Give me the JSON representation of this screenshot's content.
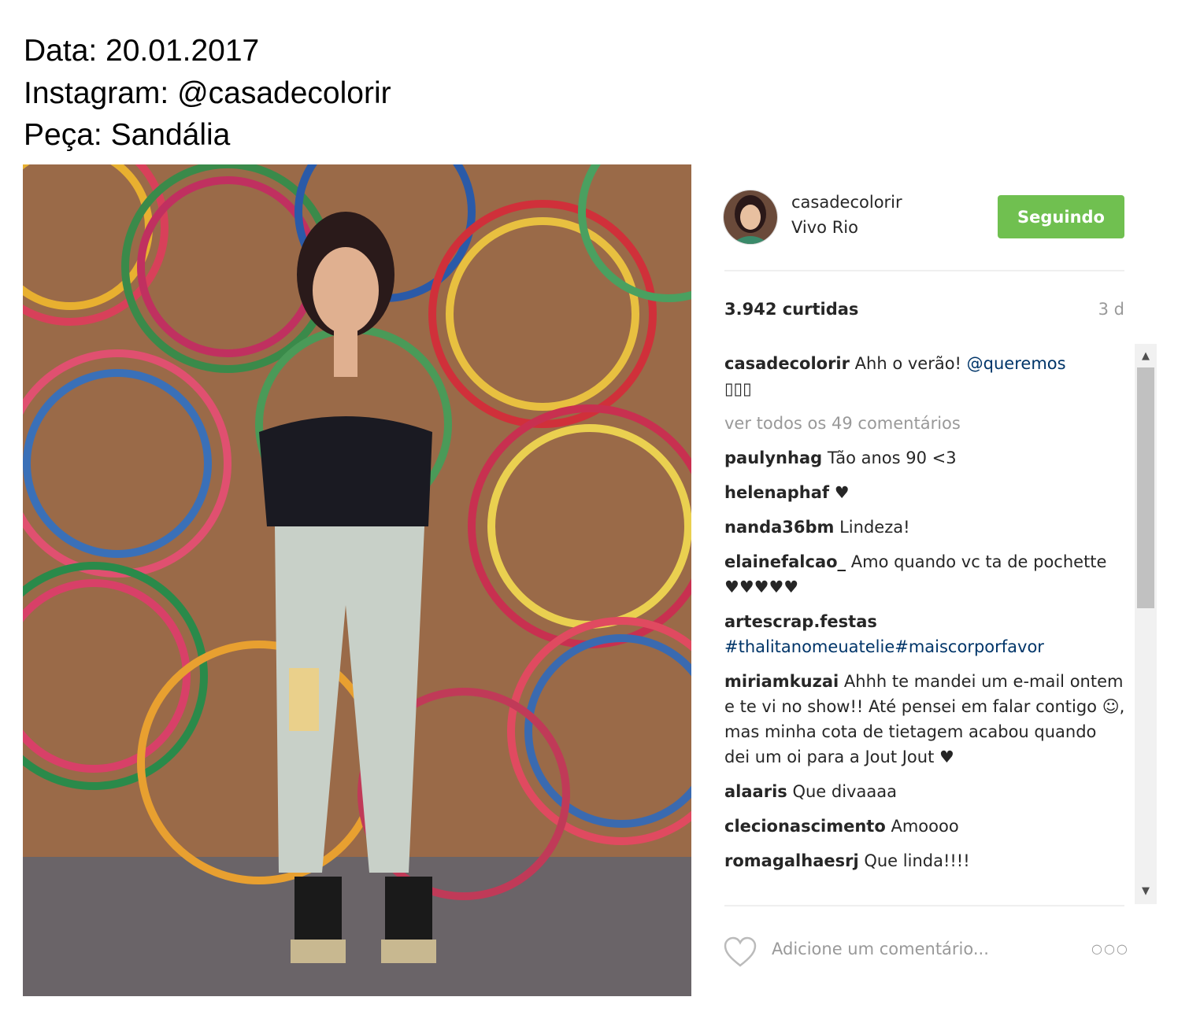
{
  "caption_header": {
    "line1": "Data: 20.01.2017",
    "line2": "Instagram: @casadecolorir",
    "line3": "Peça: Sandália"
  },
  "post": {
    "username": "casadecolorir",
    "location": "Vivo Rio",
    "follow_label": "Seguindo",
    "likes": "3.942 curtidas",
    "age": "3 d",
    "caption_user": "casadecolorir",
    "caption_text": "Ahh o verão!",
    "caption_mention": "@queremos",
    "caption_emoji": "▯▯▯",
    "view_all": "ver todos os 49 comentários",
    "add_comment_placeholder": "Adicione um comentário...",
    "more_label": "○○○"
  },
  "comments": [
    {
      "user": "paulynhag",
      "text": "Tão anos 90 <3"
    },
    {
      "user": "helenaphaf",
      "text": "♥"
    },
    {
      "user": "nanda36bm",
      "text": "Lindeza!"
    },
    {
      "user": "elainefalcao_",
      "text": "Amo quando vc ta de pochette ♥♥♥♥♥"
    },
    {
      "user": "artescrap.festas",
      "text": "#thalitanomeuatelie#maiscorporfavor",
      "is_link": true
    },
    {
      "user": "miriamkuzai",
      "text": "Ahhh te mandei um e-mail ontem e te vi no show!! Até pensei em falar contigo ☺, mas minha cota de tietagem acabou quando dei um oi para a Jout Jout ♥"
    },
    {
      "user": "alaaris",
      "text": "Que divaaaa"
    },
    {
      "user": "clecionascimento",
      "text": "Amoooo"
    },
    {
      "user": "romagalhaesrj",
      "text": "Que linda!!!!"
    }
  ],
  "icons": {
    "heart": "heart-icon",
    "scroll_up": "▲",
    "scroll_down": "▼"
  },
  "colors": {
    "follow_button": "#70c050",
    "link": "#003569"
  }
}
